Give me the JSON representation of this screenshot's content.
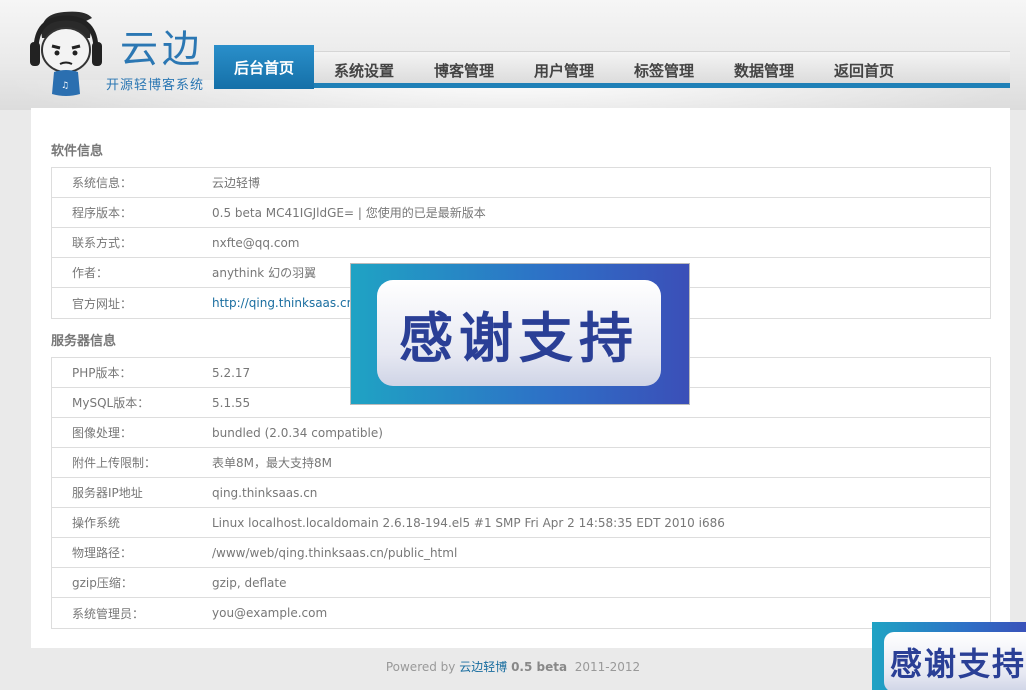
{
  "logo": {
    "title": "云边",
    "subtitle": "开源轻博客系统"
  },
  "nav": {
    "items": [
      {
        "label": "后台首页",
        "active": true
      },
      {
        "label": "系统设置"
      },
      {
        "label": "博客管理"
      },
      {
        "label": "用户管理"
      },
      {
        "label": "标签管理"
      },
      {
        "label": "数据管理"
      },
      {
        "label": "返回首页"
      }
    ]
  },
  "software": {
    "title": "软件信息",
    "rows": [
      {
        "label": "系统信息：",
        "value": "云边轻博"
      },
      {
        "label": "程序版本：",
        "value": "0.5 beta MC41IGJldGE= | 您使用的已是最新版本"
      },
      {
        "label": "联系方式：",
        "value": "nxfte@qq.com"
      },
      {
        "label": "作者：",
        "value": "anythink 幻の羽翼"
      },
      {
        "label": "官方网址：",
        "value": "http://qing.thinksaas.cn"
      }
    ]
  },
  "server": {
    "title": "服务器信息",
    "rows": [
      {
        "label": "PHP版本：",
        "value": "5.2.17"
      },
      {
        "label": "MySQL版本：",
        "value": "5.1.55"
      },
      {
        "label": "图像处理：",
        "value": "bundled (2.0.34 compatible)"
      },
      {
        "label": "附件上传限制：",
        "value": "表单8M，最大支持8M"
      },
      {
        "label": "服务器IP地址",
        "value": "qing.thinksaas.cn"
      },
      {
        "label": "操作系统",
        "value": "Linux localhost.localdomain 2.6.18-194.el5 #1 SMP Fri Apr 2 14:58:35 EDT 2010 i686"
      },
      {
        "label": "物理路径：",
        "value": "/www/web/qing.thinksaas.cn/public_html"
      },
      {
        "label": "gzip压缩：",
        "value": "gzip, deflate"
      },
      {
        "label": "系统管理员：",
        "value": "you@example.com"
      }
    ]
  },
  "footer": {
    "powered": "Powered by",
    "brand": "云边轻博",
    "version": "0.5 beta",
    "years": "2011-2012"
  },
  "overlay": {
    "thanks": "感谢支持"
  },
  "colors": {
    "accent": "#1f80b7",
    "link": "#1a6ea0"
  }
}
